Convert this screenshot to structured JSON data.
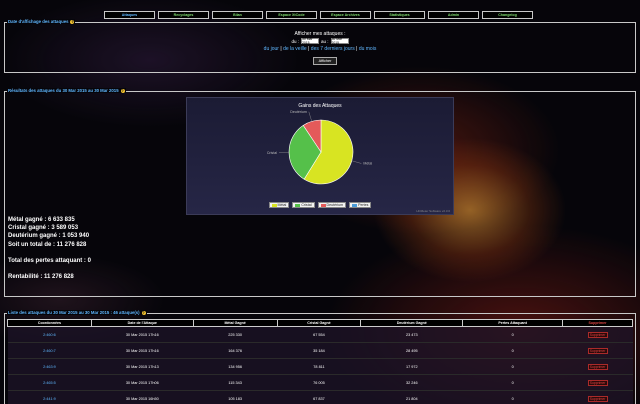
{
  "nav": {
    "tabs": [
      {
        "label": "Attaques",
        "active": true
      },
      {
        "label": "Recyclages",
        "active": false
      },
      {
        "label": "Bilan",
        "active": false
      },
      {
        "label": "Espace XtCode",
        "active": false
      },
      {
        "label": "Espace Archives",
        "active": false
      },
      {
        "label": "Statistiques",
        "active": false
      },
      {
        "label": "Admin",
        "active": false
      },
      {
        "label": "Changelog",
        "active": false
      }
    ]
  },
  "display_box": {
    "legend": "Date d'affichage des attaques",
    "title": "Afficher mes attaques :",
    "du_label": "du :",
    "from_date": "30 Mar 2015",
    "au_label": "au :",
    "to_date": "30 Mar 2015",
    "links": [
      "du jour",
      "de la veille",
      "des 7 derniers jours",
      "du mois"
    ],
    "submit_label": "Afficher"
  },
  "results_box": {
    "legend": "Résultats des attaques du 30 Mar 2015 au 30 Mar 2015",
    "chart_title": "Gains des Attaques",
    "credit": "HCMeter Software v2.3.0",
    "stats": {
      "metal": "Métal gagné : 6 633 835",
      "cristal": "Cristal gagné : 3 589 053",
      "deut": "Deutérium gagné : 1 053 940",
      "total": "Soit un total de : 11 276 828",
      "losses": "Total des pertes attaquant : 0",
      "rentability": "Rentabilité : 11 276 828"
    }
  },
  "chart_data": {
    "type": "pie",
    "title": "Gains des Attaques",
    "categories": [
      "Métal",
      "Cristal",
      "Deutérium",
      "Pertes"
    ],
    "values": [
      6633835,
      3589053,
      1053940,
      0
    ],
    "colors": [
      "#d8e422",
      "#55c04a",
      "#e45a5a",
      "#4a9ad8"
    ],
    "legend_position": "bottom"
  },
  "list_box": {
    "legend": "Liste des attaques du 30 Mar 2015 au 30 Mar 2015 : 46 attaque(s)",
    "headers": [
      "Coordonnées",
      "Date de l'Attaque",
      "Métal Gagné",
      "Cristal Gagné",
      "Deutérium Gagné",
      "Pertes Attaquant",
      "Supprimer"
    ],
    "rows": [
      {
        "coord": "2:460:6",
        "date": "30 Mar 2015 17h16",
        "metal": "225 330",
        "cristal": "67 554",
        "deut": "23 473",
        "losses": "0"
      },
      {
        "coord": "2:460:7",
        "date": "30 Mar 2015 17h16",
        "metal": "164 376",
        "cristal": "35 184",
        "deut": "28 495",
        "losses": "0"
      },
      {
        "coord": "2:463:9",
        "date": "30 Mar 2015 17h13",
        "metal": "134 956",
        "cristal": "78 811",
        "deut": "17 972",
        "losses": "0"
      },
      {
        "coord": "2:465:5",
        "date": "30 Mar 2015 17h06",
        "metal": "115 343",
        "cristal": "76 005",
        "deut": "32 246",
        "losses": "0"
      },
      {
        "coord": "2:441:9",
        "date": "30 Mar 2015 16h50",
        "metal": "105 183",
        "cristal": "67 837",
        "deut": "21 804",
        "losses": "0"
      }
    ],
    "delete_label": "Supprimer"
  }
}
